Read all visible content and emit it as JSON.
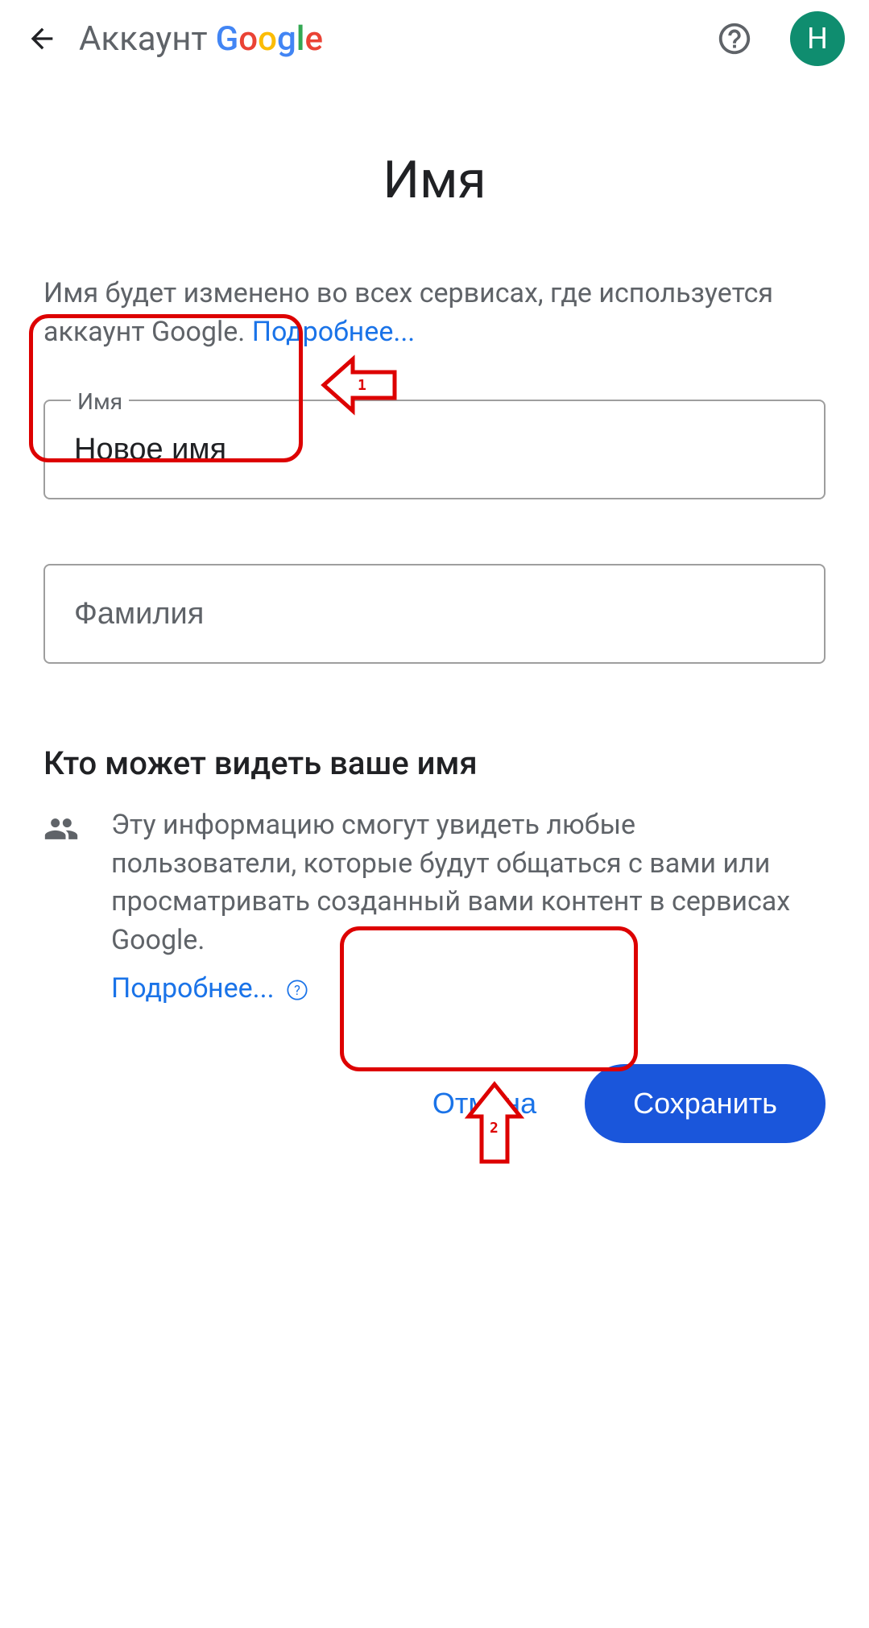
{
  "header": {
    "account_label": "Аккаунт",
    "avatar_letter": "Н"
  },
  "page": {
    "title": "Имя",
    "description_text": "Имя будет изменено во всех сервисах, где ис­пользуется аккаунт Google. ",
    "description_link": "Подробнее..."
  },
  "fields": {
    "first_name": {
      "label": "Имя",
      "value": "Новое имя"
    },
    "last_name": {
      "placeholder": "Фамилия",
      "value": ""
    }
  },
  "visibility": {
    "heading": "Кто может видеть ваше имя",
    "body": "Эту информацию смогут увидеть любые пользователи, которые будут общаться с вами или просматривать созданный вами контент в сервисах Google.",
    "link": "Подробнее..."
  },
  "actions": {
    "cancel": "Отмена",
    "save": "Сохранить"
  },
  "annotations": {
    "marker_1": "1",
    "marker_2": "2"
  }
}
